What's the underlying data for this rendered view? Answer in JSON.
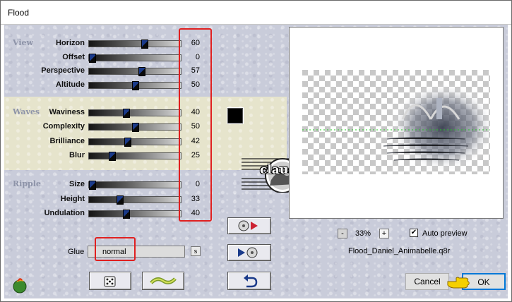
{
  "window": {
    "title": "Flood"
  },
  "sections": {
    "view": "View",
    "waves": "Waves",
    "ripple": "Ripple"
  },
  "params": [
    {
      "label": "Horizon",
      "value": "60",
      "level": 0.6
    },
    {
      "label": "Offset",
      "value": "0",
      "level": 0.0
    },
    {
      "label": "Perspective",
      "value": "57",
      "level": 0.57
    },
    {
      "label": "Altitude",
      "value": "50",
      "level": 0.5
    },
    {
      "label": "Waviness",
      "value": "40",
      "level": 0.4
    },
    {
      "label": "Complexity",
      "value": "50",
      "level": 0.5
    },
    {
      "label": "Brilliance",
      "value": "42",
      "level": 0.42
    },
    {
      "label": "Blur",
      "value": "25",
      "level": 0.25
    },
    {
      "label": "Size",
      "value": "0",
      "level": 0.0
    },
    {
      "label": "Height",
      "value": "33",
      "level": 0.33
    },
    {
      "label": "Undulation",
      "value": "40",
      "level": 0.4
    }
  ],
  "color_swatch": "#000000",
  "glue": {
    "label": "Glue",
    "value": "normal",
    "s_label": "s"
  },
  "watermark": "claudia",
  "zoom": {
    "minus": "-",
    "value": "33%",
    "plus": "+"
  },
  "auto_preview": {
    "label": "Auto preview",
    "checked": true
  },
  "preset_file": "Flood_Daniel_Animabelle.q8r",
  "buttons": {
    "cancel": "Cancel",
    "ok": "OK"
  },
  "colors": {
    "highlight": "#e02020",
    "accent_blue": "#1a3a8a"
  }
}
